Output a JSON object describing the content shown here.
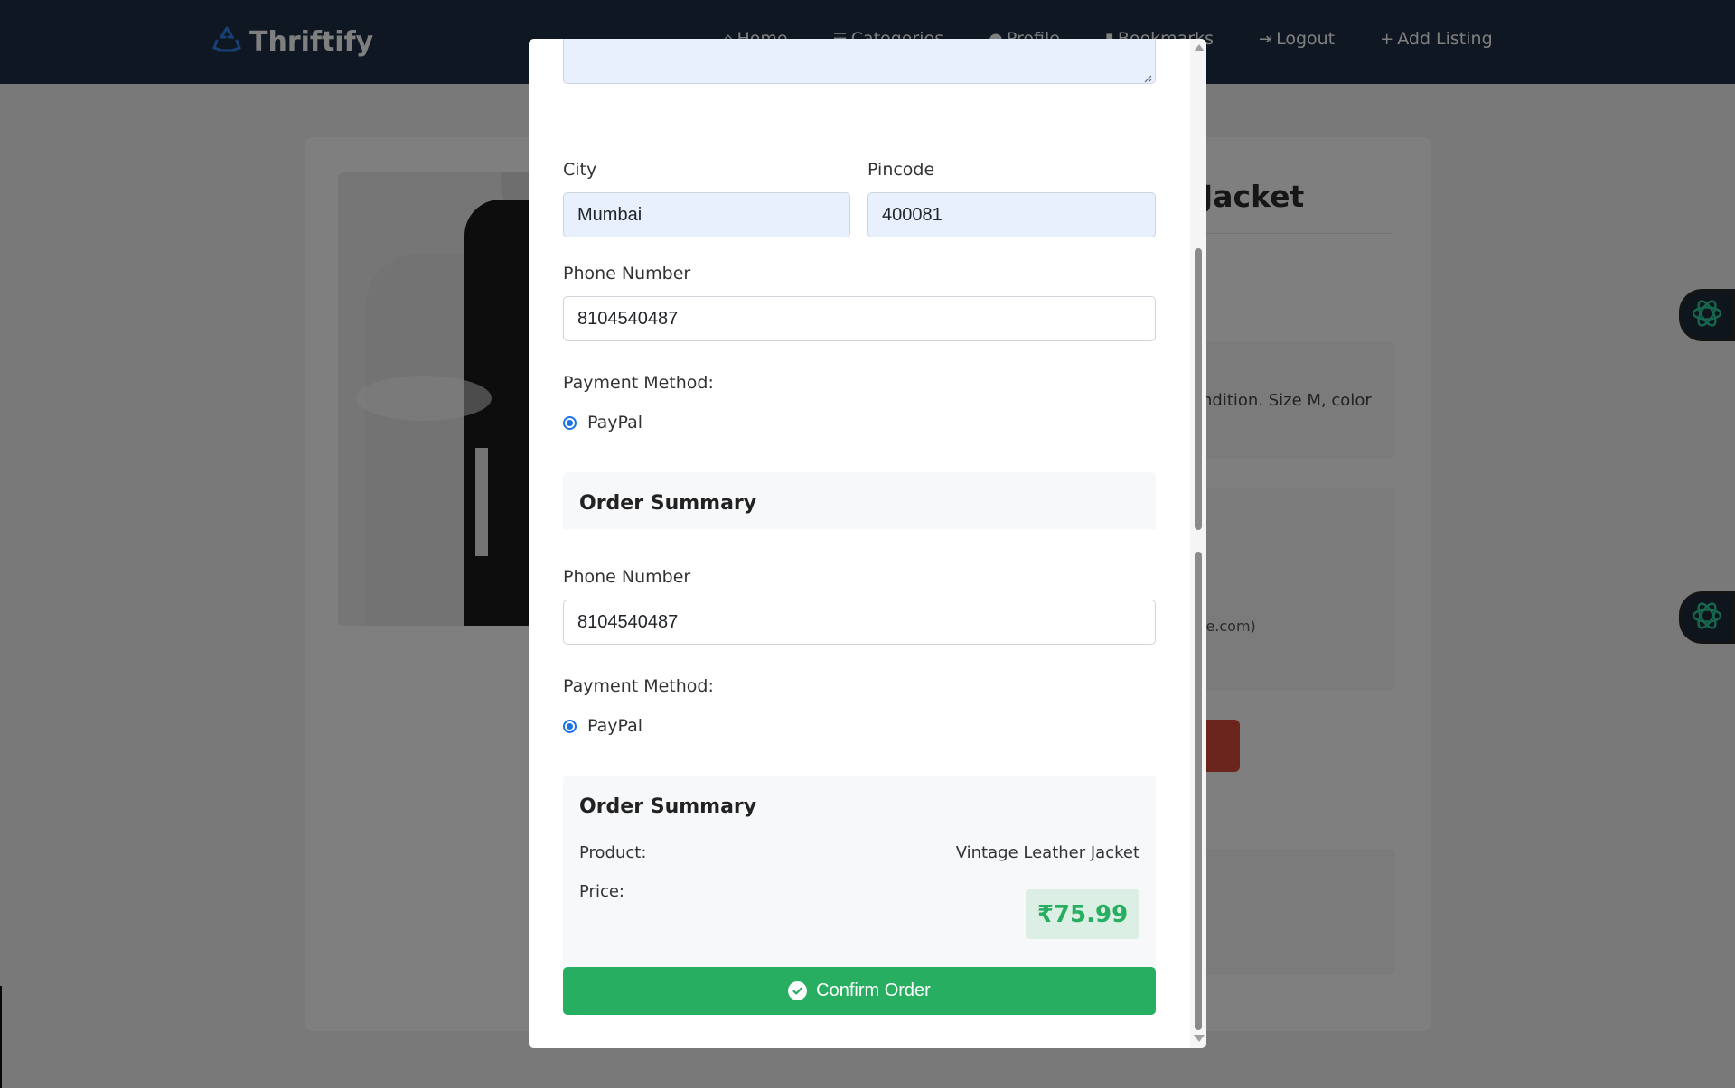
{
  "navbar": {
    "brand": "Thriftify",
    "links": [
      {
        "label": "Home",
        "icon": "home-icon"
      },
      {
        "label": "Categories",
        "icon": "list-icon"
      },
      {
        "label": "Profile",
        "icon": "user-icon"
      },
      {
        "label": "Bookmarks",
        "icon": "bookmark-icon"
      },
      {
        "label": "Logout",
        "icon": "logout-icon"
      },
      {
        "label": "Add Listing",
        "icon": "plus-icon"
      }
    ]
  },
  "product": {
    "title_visible": "Jacket",
    "description_visible": "ndition. Size M, color",
    "seller_visible": "le.com)",
    "info_visible": "."
  },
  "modal": {
    "city_label": "City",
    "city_value": "Mumbai",
    "pincode_label": "Pincode",
    "pincode_value": "400081",
    "phone_label": "Phone Number",
    "phone_value": "8104540487",
    "payment_label": "Payment Method:",
    "payment_option": "PayPal",
    "summary_title": "Order Summary",
    "product_key": "Product:",
    "product_value": "Vintage Leather Jacket",
    "price_key": "Price:",
    "price_value": "₹75.99",
    "confirm_label": "Confirm Order"
  },
  "colors": {
    "navbar": "#1f2f44",
    "accent_green": "#27ae60",
    "radio_blue": "#1a73e8",
    "autofill_bg": "#e8f0fe"
  }
}
